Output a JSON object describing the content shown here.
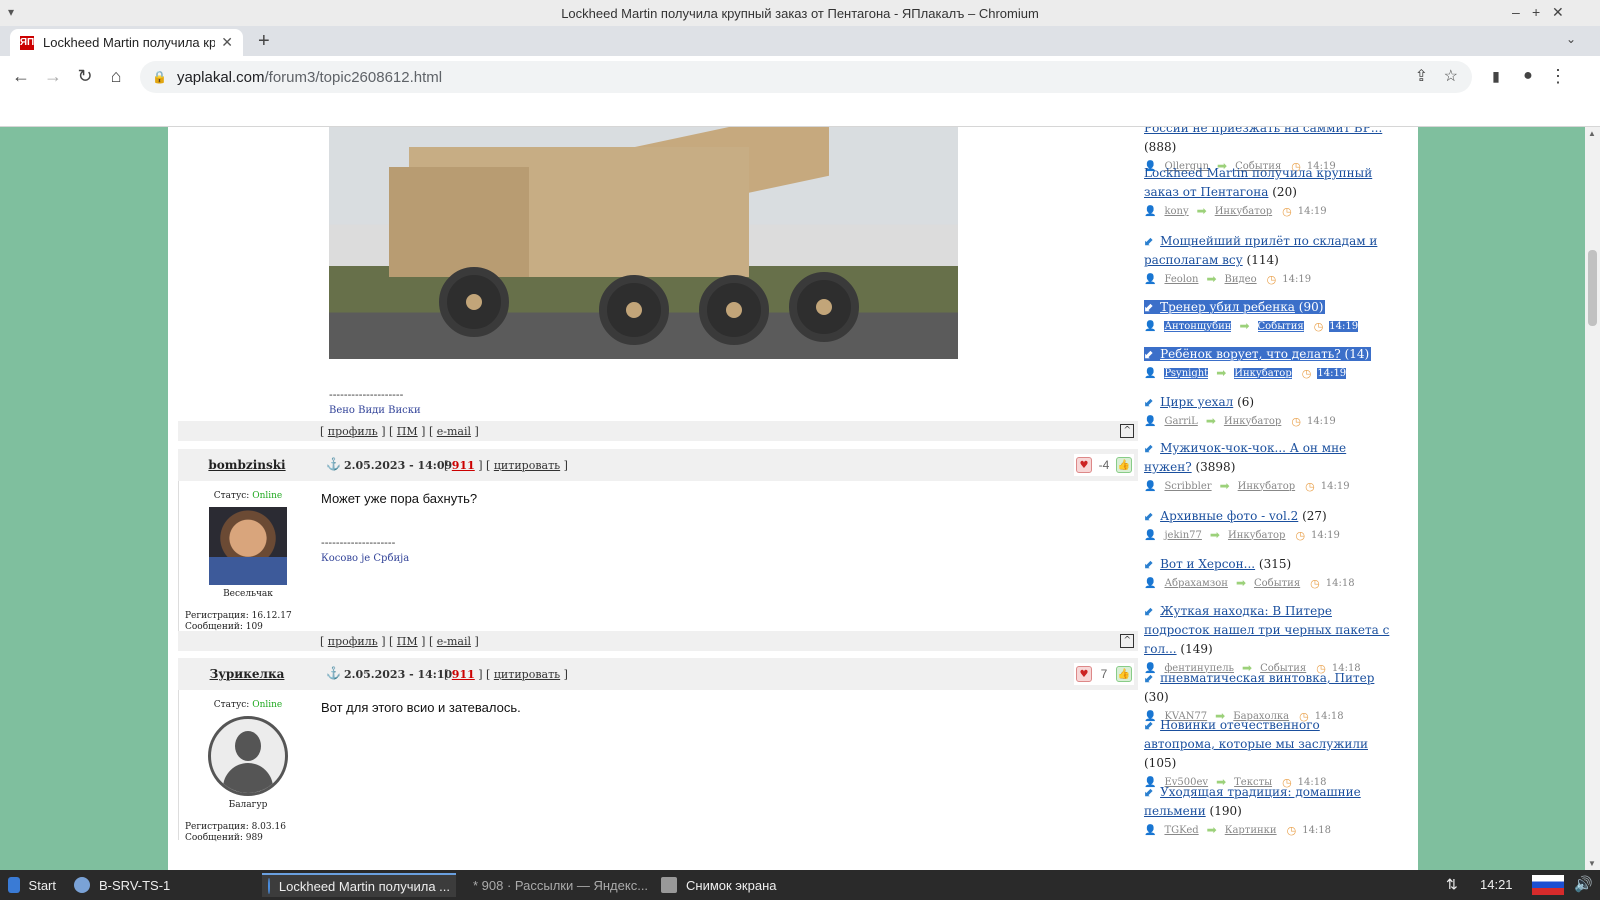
{
  "window": {
    "title": "Lockheed Martin получила крупный заказ от Пентагона - ЯПлакалъ – Chromium"
  },
  "tab": {
    "title": "Lockheed Martin получила кру",
    "favicon": "ЯП"
  },
  "address": {
    "host": "yaplakal.com",
    "path": "/forum3/topic2608612.html"
  },
  "post_prev": {
    "sig_line": "--------------------",
    "signature": "Вено Види Виски",
    "footer": {
      "profile": "профиль",
      "pm": "ПМ",
      "email": "e-mail",
      "up": "^"
    }
  },
  "posts": [
    {
      "author": "bombzinski",
      "date": "2.05.2023 - 14:09",
      "post_num": "911",
      "quote_label": "цитировать",
      "rating": "-4",
      "status_label": "Статус:",
      "status": "Online",
      "rank": "Весельчак",
      "registered": "Регистрация: 16.12.17",
      "messages": "Сообщений: 109",
      "text": "Может уже пора бахнуть?",
      "sig_line": "--------------------",
      "signature": "Косово је Србија",
      "footer": {
        "profile": "профиль",
        "pm": "ПМ",
        "email": "e-mail",
        "up": "^"
      }
    },
    {
      "author": "Зурикелка",
      "date": "2.05.2023 - 14:10",
      "post_num": "911",
      "quote_label": "цитировать",
      "rating": "7",
      "status_label": "Статус:",
      "status": "Online",
      "rank": "Балагур",
      "registered": "Регистрация: 8.03.16",
      "messages": "Сообщений: 989",
      "text": "Вот для этого всио и затевалось."
    }
  ],
  "sidebar": {
    "top_partial": {
      "title": "России не приезжать на саммит БР...",
      "count": "(888)",
      "user": "Ollergun",
      "category": "События",
      "time": "14:19"
    },
    "items": [
      {
        "title": "Lockheed Martin получила крупный заказ от Пентагона",
        "count": "(20)",
        "user": "kony",
        "category": "Инкубатор",
        "time": "14:19",
        "arrow": false,
        "selected": false
      },
      {
        "title": "Мощнейший прилёт по складам и располагам всу",
        "count": "(114)",
        "user": "Feolon",
        "category": "Видео",
        "time": "14:19",
        "arrow": true,
        "selected": false
      },
      {
        "title": "Тренер убил ребенка",
        "count": "(90)",
        "user": "Антонщубин",
        "category": "События",
        "time": "14:19",
        "arrow": true,
        "selected": true
      },
      {
        "title": "Ребёнок ворует, что делать?",
        "count": "(14)",
        "user": "Psynight",
        "category": "Инкубатор",
        "time": "14:19",
        "arrow": true,
        "selected": true
      },
      {
        "title": "Цирк уехал",
        "count": "(6)",
        "user": "GarriL",
        "category": "Инкубатор",
        "time": "14:19",
        "arrow": true,
        "selected": false
      },
      {
        "title": "Мужичок-чок-чок... А он мне нужен?",
        "count": "(3898)",
        "user": "Scribbler",
        "category": "Инкубатор",
        "time": "14:19",
        "arrow": true,
        "selected": false
      },
      {
        "title": "Архивные фото - vol.2",
        "count": "(27)",
        "user": "jekin77",
        "category": "Инкубатор",
        "time": "14:19",
        "arrow": true,
        "selected": false
      },
      {
        "title": "Вот и Херсон...",
        "count": "(315)",
        "user": "Абрахамзон",
        "category": "События",
        "time": "14:18",
        "arrow": true,
        "selected": false
      },
      {
        "title": "Жуткая находка: В Питере подросток нашел три черных пакета с гол...",
        "count": "(149)",
        "user": "фентинупель",
        "category": "События",
        "time": "14:18",
        "arrow": true,
        "selected": false
      },
      {
        "title": "пневматическая винтовка, Питер",
        "count": "(30)",
        "user": "KVAN77",
        "category": "Барахолка",
        "time": "14:18",
        "arrow": true,
        "selected": false
      },
      {
        "title": "Новинки отечественного автопрома, которые мы заслужили",
        "count": "(105)",
        "user": "Ev500ev",
        "category": "Тексты",
        "time": "14:18",
        "arrow": true,
        "selected": false
      },
      {
        "title": "Уходящая традиция: домашние пельмени",
        "count": "(190)",
        "user": "TGKed",
        "category": "Картинки",
        "time": "14:18",
        "arrow": true,
        "selected": false
      }
    ]
  },
  "taskbar": {
    "start": "Start",
    "items": [
      {
        "label": "B-SRV-TS-1"
      },
      {
        "label": "Lockheed Martin получила ..."
      },
      {
        "label": "* 908 · Рассылки — Яндекс..."
      },
      {
        "label": "Снимок экрана"
      }
    ],
    "clock": "14:21"
  }
}
